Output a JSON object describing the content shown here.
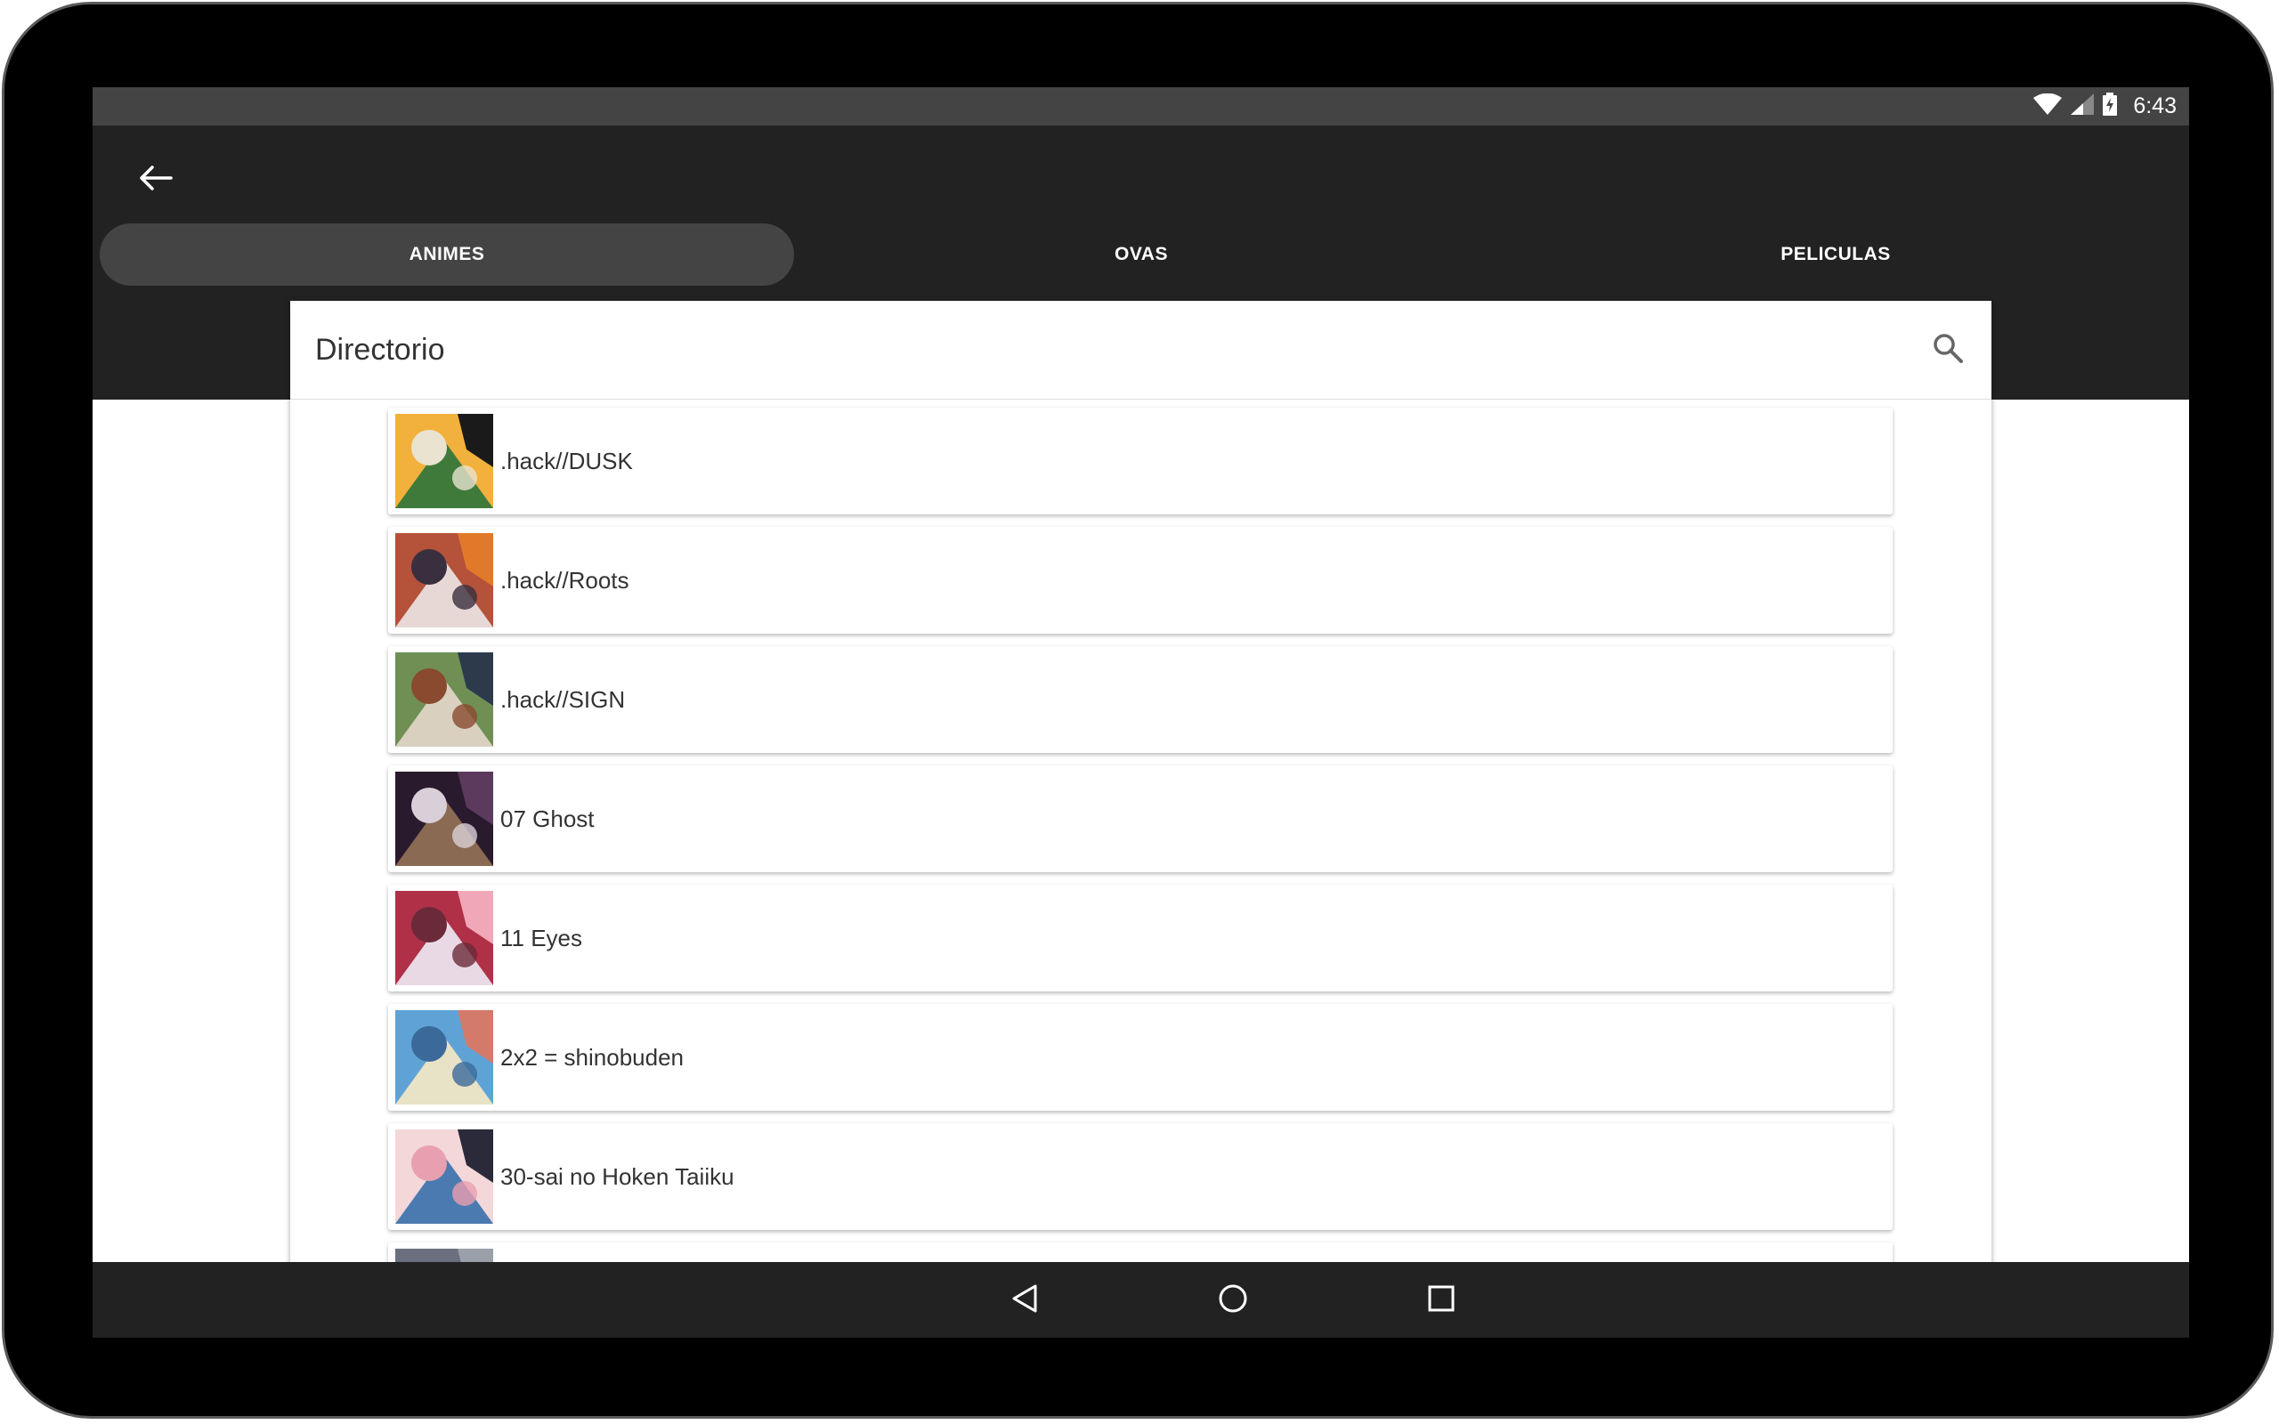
{
  "status_bar": {
    "time": "6:43",
    "icons": [
      "wifi-icon",
      "cell-signal-icon",
      "battery-charging-icon"
    ]
  },
  "app_bar": {
    "back_icon": "arrow-back-icon"
  },
  "tabs": [
    {
      "label": "ANIMES",
      "active": true
    },
    {
      "label": "OVAS",
      "active": false
    },
    {
      "label": "PELICULAS",
      "active": false
    }
  ],
  "directory": {
    "title": "Directorio",
    "search_icon": "search-icon"
  },
  "anime_list": [
    {
      "title": ".hack//DUSK",
      "colors": [
        "#f2b13c",
        "#3f7a3a",
        "#e9e3cf",
        "#1a1a1a"
      ]
    },
    {
      "title": ".hack//Roots",
      "colors": [
        "#b4523a",
        "#e7d8d6",
        "#3a2f3f",
        "#e07a2a"
      ]
    },
    {
      "title": ".hack//SIGN",
      "colors": [
        "#6f8f55",
        "#d9d0c0",
        "#8a4a2f",
        "#2c3a4c"
      ]
    },
    {
      "title": "07 Ghost",
      "colors": [
        "#2a1a2e",
        "#8a6a52",
        "#d9cfd8",
        "#5b3a5e"
      ]
    },
    {
      "title": "11 Eyes",
      "colors": [
        "#b03048",
        "#e9d9e4",
        "#6a2a3a",
        "#f0a8b8"
      ]
    },
    {
      "title": "2x2 = shinobuden",
      "colors": [
        "#5fa3d6",
        "#e8e2c6",
        "#3b6a9a",
        "#d47a6a"
      ]
    },
    {
      "title": "30-sai no Hoken Taiiku",
      "colors": [
        "#f4d7d9",
        "#4a7ab0",
        "#e8a0b0",
        "#2a2a3a"
      ]
    },
    {
      "title": "",
      "colors": [
        "#6a7080",
        "#c0c4cc",
        "#3a3f4a",
        "#9aa0aa"
      ]
    }
  ],
  "nav_bar": {
    "back_icon": "nav-back-icon",
    "home_icon": "nav-home-icon",
    "recents_icon": "nav-recents-icon"
  },
  "colors": {
    "app_bar": "#222222",
    "status_bar": "#444444",
    "active_tab": "#444444",
    "text": "#333333"
  }
}
